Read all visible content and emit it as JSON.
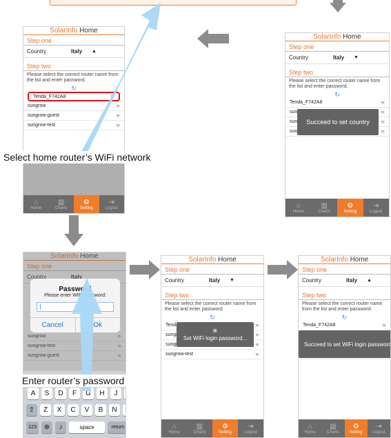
{
  "app": {
    "title_colored": "SolarInfo",
    "title_dark": "Home",
    "step_one": "Step one",
    "step_two": "Step two",
    "country_label": "Country",
    "country_value": "Italy",
    "instruction": "Please select the correct router name from the list and enter password.",
    "networks": [
      "Tenda_F742A8",
      "sungrow",
      "sungrow-guest",
      "sungrow-test"
    ],
    "tabs": [
      {
        "label": "Home",
        "icon": "home-icon"
      },
      {
        "label": "Charts",
        "icon": "chart-icon"
      },
      {
        "label": "Setting",
        "icon": "gear-icon"
      },
      {
        "label": "Logout",
        "icon": "logout-icon"
      }
    ]
  },
  "callouts": {
    "select_wifi": "Select home router’s WiFi network",
    "enter_password": "Enter router’s password"
  },
  "toasts": {
    "country": "Succeed to set country",
    "setting_wifi": "Set WiFi login password...",
    "wifi_done": "Succeed to set WiFi login password"
  },
  "dialog": {
    "title": "Password",
    "subtitle": "Please enter WIFI password:",
    "cancel": "Cancel",
    "ok": "Ok"
  },
  "keyboard": {
    "row2": [
      "A",
      "S",
      "D",
      "F",
      "G",
      "H",
      "J",
      "K",
      "L"
    ],
    "row3": [
      "Z",
      "X",
      "C",
      "V",
      "B",
      "N",
      "M"
    ],
    "num_key": "123",
    "space_key": "space",
    "return_key": "return"
  },
  "colors": {
    "accent": "#ef7d2a",
    "highlight": "#e0101c",
    "arrow_blue": "#a8d8f5",
    "arrow_gray": "#8c8c8c"
  }
}
